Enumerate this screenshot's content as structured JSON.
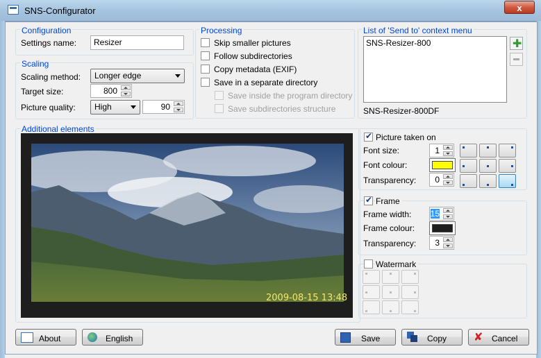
{
  "window": {
    "title": "SNS-Configurator",
    "close_glyph": "x"
  },
  "configuration": {
    "title": "Configuration",
    "settings_name_label": "Settings name:",
    "settings_name_value": "Resizer"
  },
  "scaling": {
    "title": "Scaling",
    "method_label": "Scaling method:",
    "method_value": "Longer edge",
    "target_label": "Target size:",
    "target_value": "800",
    "quality_label": "Picture quality:",
    "quality_value": "High",
    "quality_number": "90"
  },
  "processing": {
    "title": "Processing",
    "options": [
      {
        "label": "Skip smaller pictures",
        "checked": false,
        "enabled": true
      },
      {
        "label": "Follow subdirectories",
        "checked": false,
        "enabled": true
      },
      {
        "label": "Copy metadata (EXIF)",
        "checked": false,
        "enabled": true
      },
      {
        "label": "Save in a separate directory",
        "checked": false,
        "enabled": true
      },
      {
        "label": "Save inside the program directory",
        "checked": false,
        "enabled": false
      },
      {
        "label": "Save subdirectories structure",
        "checked": false,
        "enabled": false
      }
    ]
  },
  "sendto": {
    "title": "List of 'Send to' context menu",
    "items": [
      "SNS-Resizer-800"
    ],
    "add_icon": "plus-icon",
    "remove_icon": "minus-icon",
    "current_name": "SNS-Resizer-800DF"
  },
  "additional": {
    "title": "Additional elements",
    "timestamp": "2009-08-15 13:48"
  },
  "picture_taken": {
    "label": "Picture taken on",
    "checked": true,
    "font_size_label": "Font size:",
    "font_size_value": "1",
    "font_colour_label": "Font colour:",
    "font_colour": "#ffff00",
    "transparency_label": "Transparency:",
    "transparency_value": "0",
    "selected_position": "bottom-right"
  },
  "frame": {
    "label": "Frame",
    "checked": true,
    "width_label": "Frame width:",
    "width_value": "15",
    "colour_label": "Frame colour:",
    "colour": "#1e1e1e",
    "transparency_label": "Transparency:",
    "transparency_value": "3"
  },
  "watermark": {
    "label": "Watermark",
    "checked": false
  },
  "buttons": {
    "about": "About",
    "language": "English",
    "save": "Save",
    "copy": "Copy",
    "cancel": "Cancel"
  },
  "colors": {
    "group_title": "#0046d5",
    "accent": "#3c7fb1"
  }
}
